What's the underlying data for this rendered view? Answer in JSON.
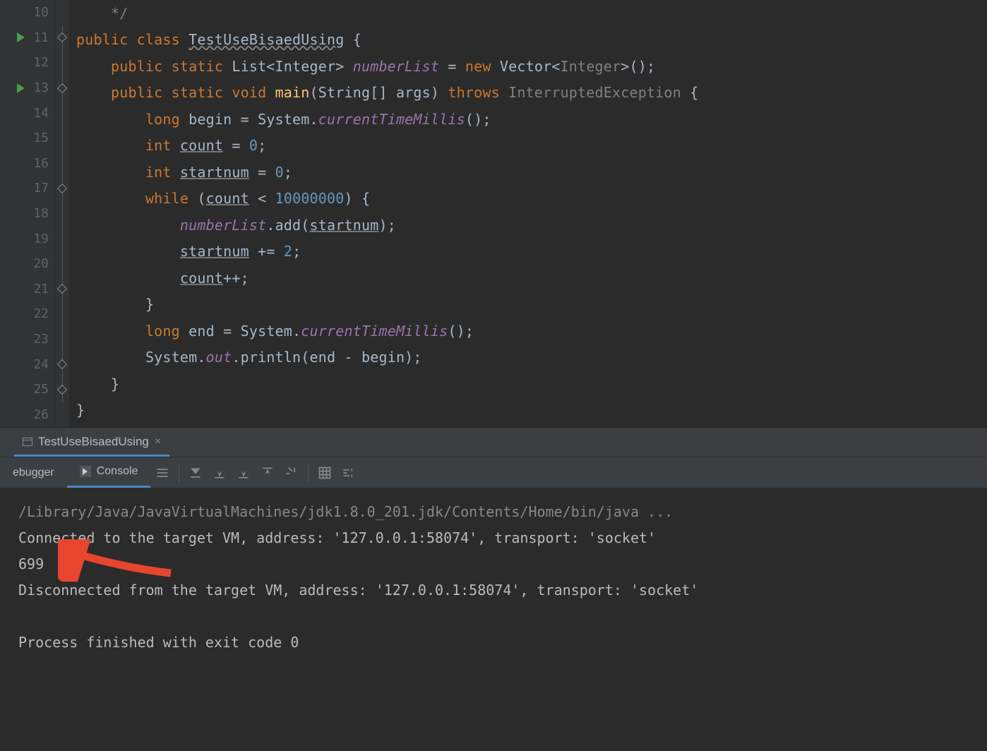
{
  "editor": {
    "lines": [
      {
        "num": "10",
        "run": false,
        "fold": "",
        "t": [
          {
            "c": "cmt",
            "v": "*/"
          }
        ],
        "indent": 4
      },
      {
        "num": "11",
        "run": true,
        "fold": "h",
        "t": [
          {
            "c": "k",
            "v": "public class "
          },
          {
            "c": "cls wavy",
            "v": "TestUseBisaedUsing"
          },
          {
            "c": "",
            "v": " {"
          }
        ],
        "indent": 0
      },
      {
        "num": "12",
        "run": false,
        "fold": "l",
        "t": [
          {
            "c": "k",
            "v": "public static "
          },
          {
            "c": "",
            "v": "List<Integer> "
          },
          {
            "c": "field",
            "v": "numberList"
          },
          {
            "c": "",
            "v": " = "
          },
          {
            "c": "k",
            "v": "new"
          },
          {
            "c": "",
            "v": " Vector<"
          },
          {
            "c": "cmt",
            "v": "Integer"
          },
          {
            "c": "",
            "v": ">();"
          }
        ],
        "indent": 4
      },
      {
        "num": "13",
        "run": true,
        "fold": "h",
        "t": [
          {
            "c": "k",
            "v": "public static void "
          },
          {
            "c": "method",
            "v": "main"
          },
          {
            "c": "",
            "v": "(String[] args) "
          },
          {
            "c": "k",
            "v": "throws "
          },
          {
            "c": "cmt",
            "v": "InterruptedException"
          },
          {
            "c": "",
            "v": " {"
          }
        ],
        "indent": 4
      },
      {
        "num": "14",
        "run": false,
        "fold": "l",
        "t": [
          {
            "c": "k",
            "v": "long "
          },
          {
            "c": "",
            "v": "begin = System."
          },
          {
            "c": "field",
            "v": "currentTimeMillis"
          },
          {
            "c": "",
            "v": "();"
          }
        ],
        "indent": 8
      },
      {
        "num": "15",
        "run": false,
        "fold": "l",
        "t": [
          {
            "c": "k",
            "v": "int "
          },
          {
            "c": "u",
            "v": "count"
          },
          {
            "c": "",
            "v": " = "
          },
          {
            "c": "num",
            "v": "0"
          },
          {
            "c": "",
            "v": ";"
          }
        ],
        "indent": 8
      },
      {
        "num": "16",
        "run": false,
        "fold": "l",
        "t": [
          {
            "c": "k",
            "v": "int "
          },
          {
            "c": "u",
            "v": "startnum"
          },
          {
            "c": "",
            "v": " = "
          },
          {
            "c": "num",
            "v": "0"
          },
          {
            "c": "",
            "v": ";"
          }
        ],
        "indent": 8
      },
      {
        "num": "17",
        "run": false,
        "fold": "h",
        "t": [
          {
            "c": "k",
            "v": "while "
          },
          {
            "c": "",
            "v": "("
          },
          {
            "c": "u",
            "v": "count"
          },
          {
            "c": "",
            "v": " < "
          },
          {
            "c": "num",
            "v": "10000000"
          },
          {
            "c": "",
            "v": ") {"
          }
        ],
        "indent": 8
      },
      {
        "num": "18",
        "run": false,
        "fold": "l",
        "t": [
          {
            "c": "field",
            "v": "numberList"
          },
          {
            "c": "",
            "v": ".add("
          },
          {
            "c": "u",
            "v": "startnum"
          },
          {
            "c": "",
            "v": ");"
          }
        ],
        "indent": 12
      },
      {
        "num": "19",
        "run": false,
        "fold": "l",
        "t": [
          {
            "c": "u",
            "v": "startnum"
          },
          {
            "c": "",
            "v": " += "
          },
          {
            "c": "num",
            "v": "2"
          },
          {
            "c": "",
            "v": ";"
          }
        ],
        "indent": 12
      },
      {
        "num": "20",
        "run": false,
        "fold": "l",
        "t": [
          {
            "c": "u",
            "v": "count"
          },
          {
            "c": "",
            "v": "++;"
          }
        ],
        "indent": 12
      },
      {
        "num": "21",
        "run": false,
        "fold": "e",
        "t": [
          {
            "c": "",
            "v": "}"
          }
        ],
        "indent": 8
      },
      {
        "num": "22",
        "run": false,
        "fold": "l",
        "t": [
          {
            "c": "k",
            "v": "long "
          },
          {
            "c": "",
            "v": "end = System."
          },
          {
            "c": "field",
            "v": "currentTimeMillis"
          },
          {
            "c": "",
            "v": "();"
          }
        ],
        "indent": 8
      },
      {
        "num": "23",
        "run": false,
        "fold": "l",
        "t": [
          {
            "c": "",
            "v": "System."
          },
          {
            "c": "field",
            "v": "out"
          },
          {
            "c": "",
            "v": ".println(end - begin);"
          }
        ],
        "indent": 8
      },
      {
        "num": "24",
        "run": false,
        "fold": "e",
        "t": [
          {
            "c": "",
            "v": "}"
          }
        ],
        "indent": 4
      },
      {
        "num": "25",
        "run": false,
        "fold": "e",
        "t": [
          {
            "c": "",
            "v": "}"
          }
        ],
        "indent": 0
      },
      {
        "num": "26",
        "run": false,
        "fold": "",
        "t": [],
        "indent": 0
      }
    ]
  },
  "runPanel": {
    "tabName": "TestUseBisaedUsing",
    "tools": {
      "debugger": "ebugger",
      "console": "Console"
    }
  },
  "console": {
    "cmd": "/Library/Java/JavaVirtualMachines/jdk1.8.0_201.jdk/Contents/Home/bin/java ...",
    "lines": [
      "Connected to the target VM, address: '127.0.0.1:58074', transport: 'socket'",
      "699",
      "Disconnected from the target VM, address: '127.0.0.1:58074', transport: 'socket'",
      "",
      "Process finished with exit code 0"
    ]
  }
}
